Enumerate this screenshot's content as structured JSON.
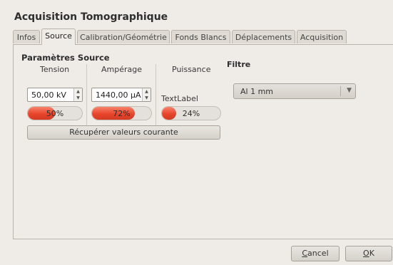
{
  "window": {
    "title": "Acquisition Tomographique"
  },
  "tabs": [
    {
      "label": "Infos"
    },
    {
      "label": "Source",
      "active": true
    },
    {
      "label": "Calibration/Géométrie"
    },
    {
      "label": "Fonds Blancs"
    },
    {
      "label": "Déplacements"
    },
    {
      "label": "Acquisition"
    }
  ],
  "source_group": {
    "title": "Paramètres Source",
    "tension": {
      "label": "Tension",
      "value": "50,00 kV",
      "progress_text": "50%",
      "progress": 0.5
    },
    "amperage": {
      "label": "Ampérage",
      "value": "1440,00 µA",
      "progress_text": "72%",
      "progress": 0.72
    },
    "puissance": {
      "label": "Puissance",
      "text_label": "TextLabel",
      "progress_text": "24%",
      "progress": 0.24
    },
    "fetch_button": "Récupérer valeurs courante"
  },
  "filter": {
    "title": "Filtre",
    "selected": "Al 1 mm"
  },
  "buttons": {
    "cancel": {
      "mnemonic": "C",
      "rest": "ancel"
    },
    "ok": {
      "mnemonic": "O",
      "rest": "K"
    }
  },
  "colors": {
    "progress_fill": "#e8452c",
    "window_bg": "#efebe7"
  }
}
